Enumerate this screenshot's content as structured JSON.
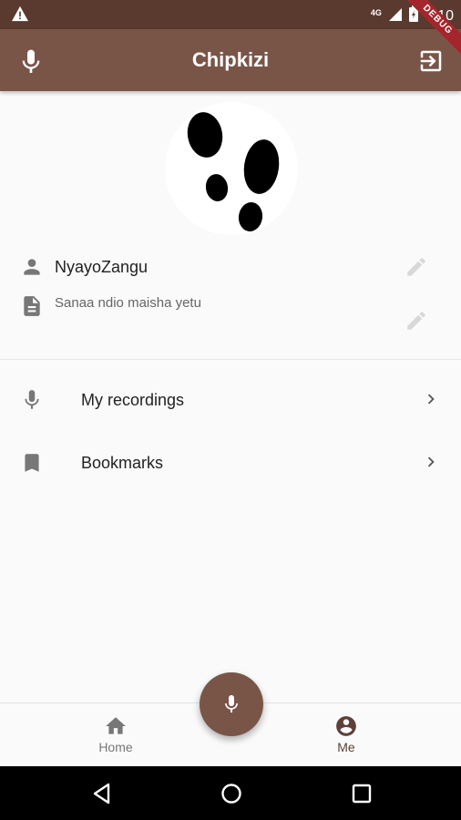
{
  "status_bar": {
    "time": "7:10",
    "network": "4G",
    "debug_banner": "DEBUG",
    "icons": [
      "warning-icon",
      "signal-icon",
      "battery-icon"
    ]
  },
  "app_bar": {
    "title": "Chipkizi",
    "left_icon": "mic-icon",
    "right_icon": "logout-icon"
  },
  "profile": {
    "avatar_icon": "footprints-icon",
    "username": "NyayoZangu",
    "bio": "Sanaa ndio maisha yetu"
  },
  "menu": [
    {
      "label": "My recordings",
      "icon": "mic-icon"
    },
    {
      "label": "Bookmarks",
      "icon": "bookmark-icon"
    }
  ],
  "bottom_nav": {
    "tabs": [
      {
        "label": "Home",
        "icon": "home-icon",
        "active": false
      },
      {
        "label": "Me",
        "icon": "account-circle-icon",
        "active": true
      }
    ],
    "fab_icon": "mic-icon"
  },
  "colors": {
    "primary": "#795548",
    "status_bar": "#5a3a2e",
    "active_tab": "#5d4037",
    "inactive_tab": "#777777"
  }
}
